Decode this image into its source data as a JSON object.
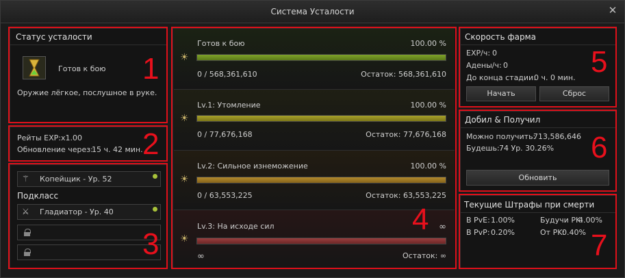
{
  "window": {
    "title": "Система Усталости"
  },
  "status": {
    "header": "Статус усталости",
    "state": "Готов к бою",
    "description": "Оружие лёгкое, послушное в руке."
  },
  "rates": {
    "exp_label": "Рейты EXP:",
    "exp_value": "x1.00",
    "update_label": "Обновление через:",
    "update_value": "15 ч. 42 мин."
  },
  "classes": {
    "main": "Копейщик - Ур. 52",
    "subclass_header": "Подкласс",
    "sub1": "Гладиатор - Ур. 40"
  },
  "stages": [
    {
      "name": "Готов к бою",
      "percent": "100.00 %",
      "progress": "0 / 568,361,610",
      "remaining": "Остаток: 568,361,610",
      "fill": 1.0,
      "color": "#7ea12a",
      "color2": "#5b7a18"
    },
    {
      "name": "Lv.1: Утомление",
      "percent": "100.00 %",
      "progress": "0 / 77,676,168",
      "remaining": "Остаток: 77,676,168",
      "fill": 1.0,
      "color": "#a7a12a",
      "color2": "#7c7618"
    },
    {
      "name": "Lv.2: Сильное изнеможение",
      "percent": "100.00 %",
      "progress": "0 / 63,553,225",
      "remaining": "Остаток: 63,553,225",
      "fill": 1.0,
      "color": "#b38a2c",
      "color2": "#86641a"
    },
    {
      "name": "Lv.3: На исходе сил",
      "percent": "∞",
      "progress": "∞",
      "remaining": "Остаток: ∞",
      "fill": 1.0,
      "color": "#9a3f3f",
      "color2": "#6d2626"
    }
  ],
  "farm": {
    "header": "Скорость фарма",
    "exp_label": "EXP/ч:",
    "exp_value": "0",
    "adena_label": "Адены/ч:",
    "adena_value": "0",
    "stage_label": "До конца стадии:",
    "stage_value": "0 ч. 0 мин.",
    "start_button": "Начать",
    "reset_button": "Сброс"
  },
  "kill": {
    "header": "Добил & Получил",
    "can_label": "Можно получить:",
    "can_value": "713,586,646",
    "will_label": "Будешь:",
    "will_value": "74 Ур. 30.26%",
    "refresh_button": "Обновить"
  },
  "penalty": {
    "header": "Текущие Штрафы при смерти",
    "pve_label": "В PvE:",
    "pve_value": "1.00%",
    "pvp_label": "В PvP:",
    "pvp_value": "0.20%",
    "future_pk_label": "Будучи PK:",
    "future_pk_value": "4.00%",
    "from_pk_label": "От PK:",
    "from_pk_value": "0.40%"
  },
  "markers": [
    "1",
    "2",
    "3",
    "4",
    "5",
    "6",
    "7"
  ]
}
